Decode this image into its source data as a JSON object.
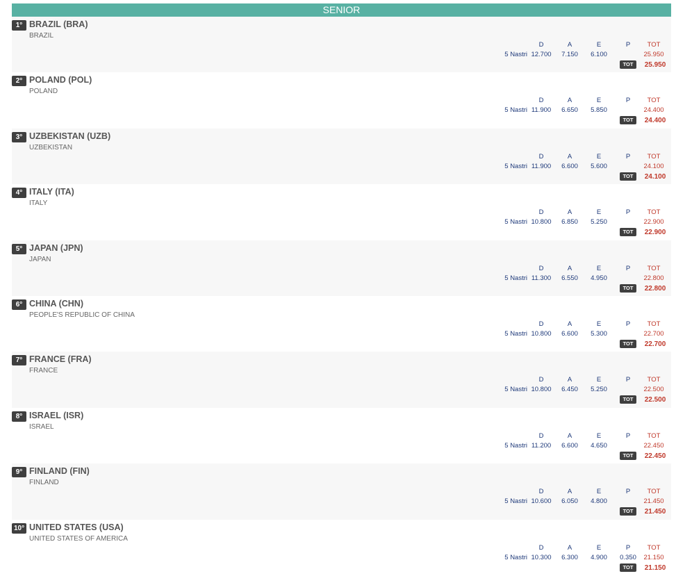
{
  "category": "SENIOR",
  "headers": {
    "d": "D",
    "a": "A",
    "e": "E",
    "p": "P",
    "tot": "TOT"
  },
  "tot_badge": "TOT",
  "colors": {
    "header_bg": "#58b1a3",
    "badge_bg": "#3f3f3f",
    "score_blue": "#1f3a7a",
    "score_red": "#c0392b"
  },
  "rows": [
    {
      "rank": "1°",
      "team": "BRAZIL (BRA)",
      "full": "BRAZIL",
      "apparatus": "5 Nastri",
      "d": "12.700",
      "a": "7.150",
      "e": "6.100",
      "p": "",
      "tot": "25.950",
      "final": "25.950"
    },
    {
      "rank": "2°",
      "team": "POLAND (POL)",
      "full": "POLAND",
      "apparatus": "5 Nastri",
      "d": "11.900",
      "a": "6.650",
      "e": "5.850",
      "p": "",
      "tot": "24.400",
      "final": "24.400"
    },
    {
      "rank": "3°",
      "team": "UZBEKISTAN (UZB)",
      "full": "UZBEKISTAN",
      "apparatus": "5 Nastri",
      "d": "11.900",
      "a": "6.600",
      "e": "5.600",
      "p": "",
      "tot": "24.100",
      "final": "24.100"
    },
    {
      "rank": "4°",
      "team": "ITALY (ITA)",
      "full": "ITALY",
      "apparatus": "5 Nastri",
      "d": "10.800",
      "a": "6.850",
      "e": "5.250",
      "p": "",
      "tot": "22.900",
      "final": "22.900"
    },
    {
      "rank": "5°",
      "team": "JAPAN (JPN)",
      "full": "JAPAN",
      "apparatus": "5 Nastri",
      "d": "11.300",
      "a": "6.550",
      "e": "4.950",
      "p": "",
      "tot": "22.800",
      "final": "22.800"
    },
    {
      "rank": "6°",
      "team": "CHINA (CHN)",
      "full": "PEOPLE'S REPUBLIC OF CHINA",
      "apparatus": "5 Nastri",
      "d": "10.800",
      "a": "6.600",
      "e": "5.300",
      "p": "",
      "tot": "22.700",
      "final": "22.700"
    },
    {
      "rank": "7°",
      "team": "FRANCE (FRA)",
      "full": "FRANCE",
      "apparatus": "5 Nastri",
      "d": "10.800",
      "a": "6.450",
      "e": "5.250",
      "p": "",
      "tot": "22.500",
      "final": "22.500"
    },
    {
      "rank": "8°",
      "team": "ISRAEL (ISR)",
      "full": "ISRAEL",
      "apparatus": "5 Nastri",
      "d": "11.200",
      "a": "6.600",
      "e": "4.650",
      "p": "",
      "tot": "22.450",
      "final": "22.450"
    },
    {
      "rank": "9°",
      "team": "FINLAND (FIN)",
      "full": "FINLAND",
      "apparatus": "5 Nastri",
      "d": "10.600",
      "a": "6.050",
      "e": "4.800",
      "p": "",
      "tot": "21.450",
      "final": "21.450"
    },
    {
      "rank": "10°",
      "team": "UNITED STATES (USA)",
      "full": "UNITED STATES OF AMERICA",
      "apparatus": "5 Nastri",
      "d": "10.300",
      "a": "6.300",
      "e": "4.900",
      "p": "0.350",
      "tot": "21.150",
      "final": "21.150"
    }
  ]
}
